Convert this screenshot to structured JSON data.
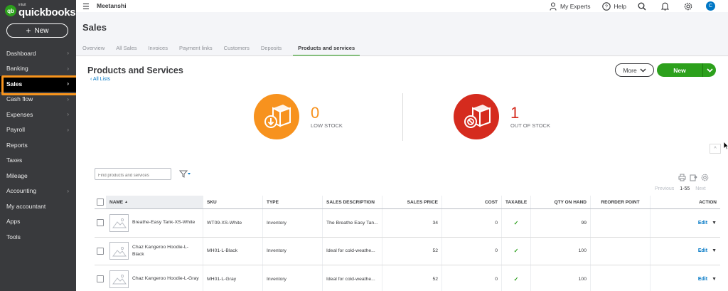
{
  "sidebar": {
    "logo_small": "intuit",
    "logo_main": "quickbooks",
    "logo_badge": "qb",
    "new_label": "New",
    "items": [
      {
        "label": "Dashboard",
        "chevron": true
      },
      {
        "label": "Banking",
        "chevron": true
      },
      {
        "label": "Sales",
        "chevron": true,
        "active": true
      },
      {
        "label": "Cash flow",
        "chevron": true
      },
      {
        "label": "Expenses",
        "chevron": true
      },
      {
        "label": "Payroll",
        "chevron": true
      },
      {
        "label": "Reports",
        "chevron": false
      },
      {
        "label": "Taxes",
        "chevron": false
      },
      {
        "label": "Mileage",
        "chevron": false
      },
      {
        "label": "Accounting",
        "chevron": true
      },
      {
        "label": "My accountant",
        "chevron": false
      },
      {
        "label": "Apps",
        "chevron": false
      },
      {
        "label": "Tools",
        "chevron": false
      }
    ]
  },
  "topbar": {
    "company": "Meetanshi",
    "experts_label": "My Experts",
    "help_label": "Help",
    "avatar_initial": "C"
  },
  "page": {
    "title": "Sales",
    "tabs": [
      "Overview",
      "All Sales",
      "Invoices",
      "Payment links",
      "Customers",
      "Deposits",
      "Products and services"
    ],
    "active_tab": "Products and services"
  },
  "products": {
    "title": "Products and Services",
    "all_lists": "All Lists",
    "more_label": "More",
    "new_label": "New",
    "low_stock": {
      "count": "0",
      "label": "LOW STOCK"
    },
    "out_of_stock": {
      "count": "1",
      "label": "OUT OF STOCK"
    },
    "search_placeholder": "Find products and services",
    "pager": {
      "prev": "Previous",
      "range": "1-55",
      "next": "Next"
    }
  },
  "table": {
    "headers": {
      "name": "NAME",
      "sku": "SKU",
      "type": "TYPE",
      "desc": "SALES DESCRIPTION",
      "price": "SALES PRICE",
      "cost": "COST",
      "taxable": "TAXABLE",
      "qty": "QTY ON HAND",
      "reorder": "REORDER POINT",
      "action": "ACTION"
    },
    "rows": [
      {
        "name": "Breathe-Easy Tank-XS-White",
        "sku": "WT09-XS-White",
        "type": "Inventory",
        "desc": "The Breathe Easy Tan...",
        "price": "34",
        "cost": "0",
        "taxable": true,
        "qty": "99",
        "reorder": "",
        "action": "Edit"
      },
      {
        "name": "Chaz Kangeroo Hoodie-L-Black",
        "sku": "MH01-L-Black",
        "type": "Inventory",
        "desc": "Ideal for cold-weathe...",
        "price": "52",
        "cost": "0",
        "taxable": true,
        "qty": "100",
        "reorder": "",
        "action": "Edit"
      },
      {
        "name": "Chaz Kangeroo Hoodie-L-Gray",
        "sku": "MH01-L-Gray",
        "type": "Inventory",
        "desc": "Ideal for cold-weathe...",
        "price": "52",
        "cost": "0",
        "taxable": true,
        "qty": "100",
        "reorder": "",
        "action": "Edit"
      }
    ]
  },
  "colors": {
    "brand_green": "#2ca01c",
    "sidebar_bg": "#393a3d",
    "low_stock_orange": "#f7921e",
    "out_of_stock_red": "#d52b1e",
    "link_blue": "#0077c5",
    "highlight_orange": "#f7941d"
  }
}
